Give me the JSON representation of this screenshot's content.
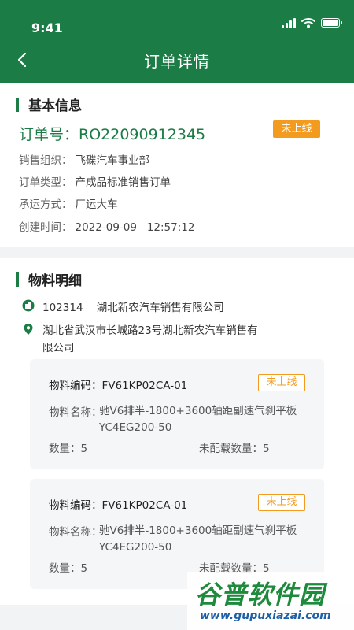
{
  "status_bar": {
    "time": "9:41"
  },
  "header": {
    "title": "订单详情"
  },
  "basic": {
    "section_title": "基本信息",
    "order_no": "订单号：RO22090912345",
    "status_tag": "未上线",
    "rows": [
      {
        "label": "销售组织：",
        "value": "飞碟汽车事业部"
      },
      {
        "label": "订单类型：",
        "value": "产成品标准销售订单"
      },
      {
        "label": "承运方式：",
        "value": "厂运大车"
      },
      {
        "label": "创建时间：",
        "value": "2022-09-09   12:57:12"
      }
    ]
  },
  "materials": {
    "section_title": "物料明细",
    "customer": "102314    湖北新农汽车销售有限公司",
    "address_line1": "湖北省武汉市长城路23号湖北新农汽车销售有",
    "address_line2": "限公司",
    "items": [
      {
        "code": "物料编码：FV61KP02CA-01",
        "status": "未上线",
        "name_label": "物料名称：",
        "name": "驰V6排半-1800+3600轴距副速气刹平板YC4EG200-50",
        "qty": "数量：5",
        "unloaded": "未配载数量：5"
      },
      {
        "code": "物料编码：FV61KP02CA-01",
        "status": "未上线",
        "name_label": "物料名称：",
        "name": "驰V6排半-1800+3600轴距副速气刹平板YC4EG200-50",
        "qty": "数量：5",
        "unloaded": "未配载数量：5"
      }
    ]
  },
  "watermark": {
    "logo": "谷普软件园",
    "url": "www.gupuxiazai.com"
  },
  "colors": {
    "primary": "#1b7c45",
    "tag": "#f29b1f"
  },
  "icons": [
    "signal-icon",
    "wifi-icon",
    "battery-icon",
    "back-arrow-icon",
    "building-icon",
    "location-pin-icon"
  ]
}
